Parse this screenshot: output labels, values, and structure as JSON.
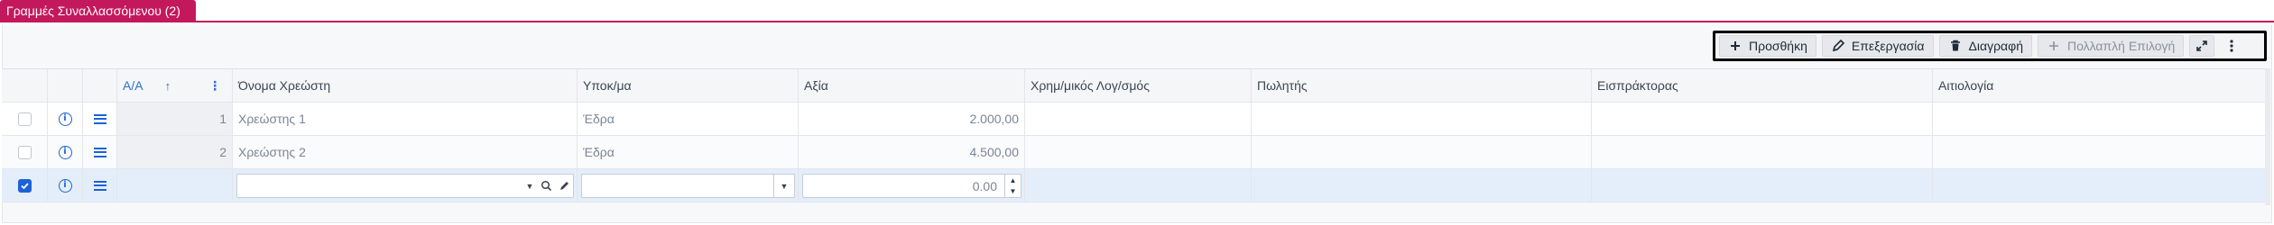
{
  "section": {
    "tab_label": "Γραμμές Συναλλασσόμενου (2)",
    "accent": "#c4185c"
  },
  "toolbar": {
    "add_label": "Προσθήκη",
    "edit_label": "Επεξεργασία",
    "delete_label": "Διαγραφή",
    "multi_select_label": "Πολλαπλή Επιλογή",
    "icons": [
      "plus-icon",
      "pencil-icon",
      "trash-icon",
      "plus-icon",
      "expand-icon",
      "kebab-icon"
    ]
  },
  "grid": {
    "columns": [
      "",
      "",
      "",
      "Α/Α",
      "Όνομα Χρεώστη",
      "Υποκ/μα",
      "Αξία",
      "Χρημ/μικός Λογ/σμός",
      "Πωλητής",
      "Εισπράκτορας",
      "Αιτιολογία"
    ],
    "rows": [
      {
        "aa": "1",
        "name": "Χρεώστης 1",
        "branch": "Έδρα",
        "value": "2.000,00",
        "account": "",
        "seller": "",
        "collector": "",
        "reason": "",
        "checked": false
      },
      {
        "aa": "2",
        "name": "Χρεώστης 2",
        "branch": "Έδρα",
        "value": "4.500,00",
        "account": "",
        "seller": "",
        "collector": "",
        "reason": "",
        "checked": false
      }
    ],
    "edit_row": {
      "name_value": "",
      "branch_value": "",
      "amount_value": "0.00",
      "checked": true
    }
  },
  "colors": {
    "brand_blue": "#1c62d6",
    "edit_row_bg": "#e4eefb",
    "toolbar_border": "#000000"
  }
}
